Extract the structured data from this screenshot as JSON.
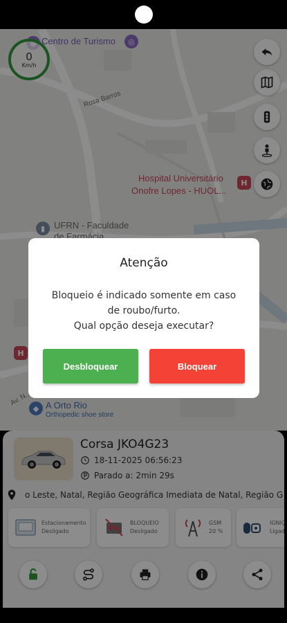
{
  "map": {
    "speed_value": "0",
    "speed_unit": "Km/h",
    "poi": {
      "tourism": "Centro de Turismo",
      "hospital_line1": "Hospital Universitário",
      "hospital_line2": "Onofre Lopes - HUOL...",
      "ufrn_line1": "UFRN - Faculdade",
      "ufrn_line2": "de Farmácia",
      "street": "Rosa Barros",
      "avenue": "Av. N...",
      "orto_name": "A Orto Rio",
      "orto_type": "Orthopedic shoe store"
    }
  },
  "dialog": {
    "title": "Atenção",
    "message_line1": "Bloqueio é indicado somente em caso",
    "message_line2": "de roubo/furto.",
    "message_line3": "Qual opção deseja executar?",
    "unlock_label": "Desbloquear",
    "lock_label": "Bloquear"
  },
  "vehicle": {
    "name": "Corsa JKO4G23",
    "datetime": "18-11-2025 06:56:23",
    "status": "Parado a: 2min 29s",
    "address": "o Leste, Natal, Região Geográfica Imediata de Natal, Região G"
  },
  "cards": [
    {
      "label": "Estacionamento",
      "value": "Desligado"
    },
    {
      "label": "BLOQUEIO",
      "value": "Desligado"
    },
    {
      "label": "GSM",
      "value": "20 %"
    },
    {
      "label": "IGNIÇ",
      "value": "Ligad"
    }
  ],
  "colors": {
    "green": "#4caf50",
    "red": "#f44336",
    "speed_ring": "#2e9a3c",
    "action_icon": "#2e9a3c"
  }
}
